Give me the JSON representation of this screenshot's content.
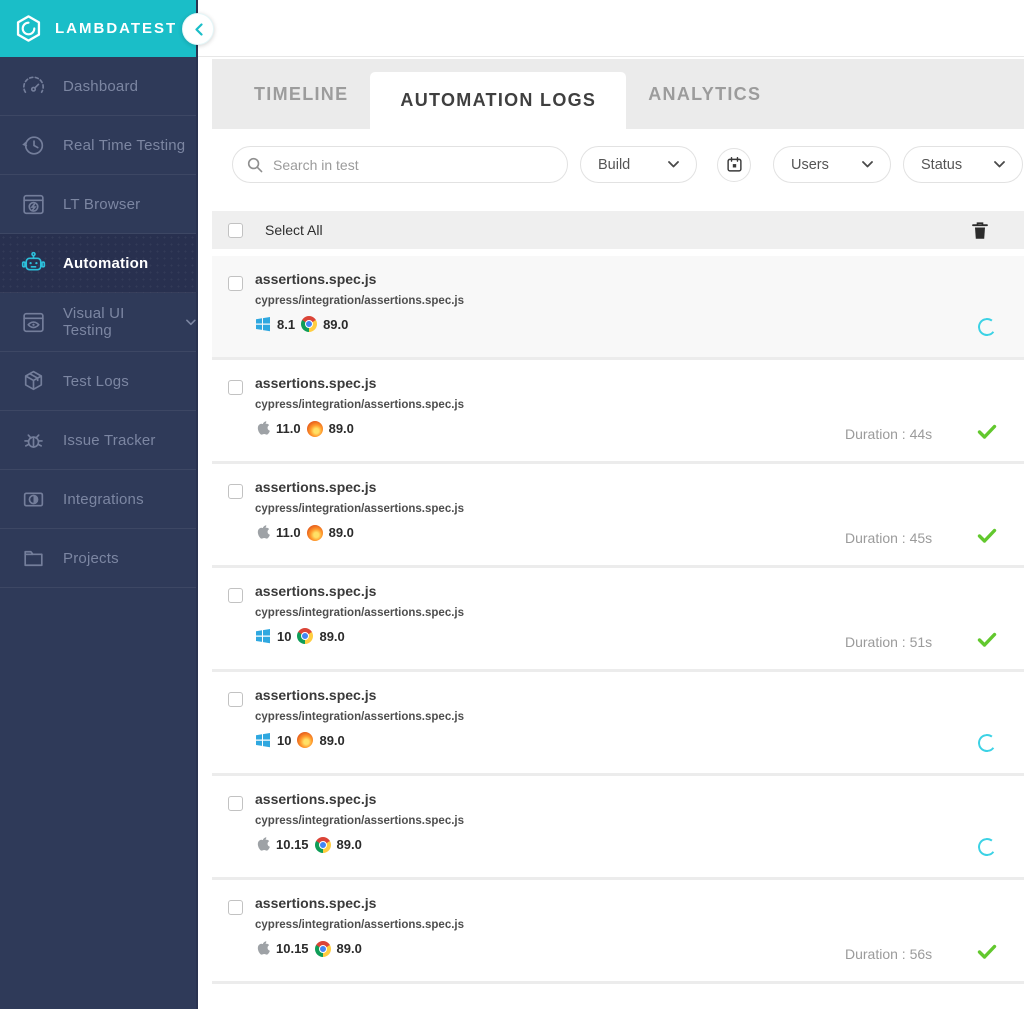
{
  "brand": {
    "name": "LAMBDATEST"
  },
  "colors": {
    "teal": "#1ABEC8",
    "sidebar_navy": "#2F3A59",
    "active_item_navy": "#28304F",
    "success_green": "#62C82E",
    "spinner_cyan": "#3CD2E5",
    "windows_blue": "#2FA8E0"
  },
  "sidebar": {
    "items": [
      {
        "label": "Dashboard",
        "icon": "dashboard-gauge-icon",
        "active": false
      },
      {
        "label": "Real Time Testing",
        "icon": "realtime-clock-icon",
        "active": false
      },
      {
        "label": "LT Browser",
        "icon": "lt-browser-icon",
        "active": false
      },
      {
        "label": "Automation",
        "icon": "automation-robot-icon",
        "active": true
      },
      {
        "label": "Visual UI Testing",
        "icon": "visual-ui-eye-icon",
        "active": false,
        "has_submenu": true
      },
      {
        "label": "Test Logs",
        "icon": "test-logs-box-icon",
        "active": false
      },
      {
        "label": "Issue Tracker",
        "icon": "issue-bug-icon",
        "active": false
      },
      {
        "label": "Integrations",
        "icon": "integrations-icon",
        "active": false
      },
      {
        "label": "Projects",
        "icon": "projects-folder-icon",
        "active": false
      }
    ]
  },
  "tabs": [
    {
      "label": "TIMELINE",
      "active": false
    },
    {
      "label": "AUTOMATION LOGS",
      "active": true
    },
    {
      "label": "ANALYTICS",
      "active": false
    }
  ],
  "filters": {
    "search_placeholder": "Search in test",
    "build": "Build",
    "users": "Users",
    "status": "Status"
  },
  "list": {
    "select_all": "Select All"
  },
  "rows": [
    {
      "title": "assertions.spec.js",
      "path": "cypress/integration/assertions.spec.js",
      "os": "windows",
      "os_version": "8.1",
      "browser": "chrome",
      "browser_version": "89.0",
      "duration": "",
      "status": "running"
    },
    {
      "title": "assertions.spec.js",
      "path": "cypress/integration/assertions.spec.js",
      "os": "apple",
      "os_version": "11.0",
      "browser": "firefox",
      "browser_version": "89.0",
      "duration": "Duration : 44s",
      "status": "passed"
    },
    {
      "title": "assertions.spec.js",
      "path": "cypress/integration/assertions.spec.js",
      "os": "apple",
      "os_version": "11.0",
      "browser": "firefox",
      "browser_version": "89.0",
      "duration": "Duration : 45s",
      "status": "passed"
    },
    {
      "title": "assertions.spec.js",
      "path": "cypress/integration/assertions.spec.js",
      "os": "windows",
      "os_version": "10",
      "browser": "chrome",
      "browser_version": "89.0",
      "duration": "Duration : 51s",
      "status": "passed"
    },
    {
      "title": "assertions.spec.js",
      "path": "cypress/integration/assertions.spec.js",
      "os": "windows",
      "os_version": "10",
      "browser": "firefox",
      "browser_version": "89.0",
      "duration": "",
      "status": "running"
    },
    {
      "title": "assertions.spec.js",
      "path": "cypress/integration/assertions.spec.js",
      "os": "apple",
      "os_version": "10.15",
      "browser": "chrome",
      "browser_version": "89.0",
      "duration": "",
      "status": "running"
    },
    {
      "title": "assertions.spec.js",
      "path": "cypress/integration/assertions.spec.js",
      "os": "apple",
      "os_version": "10.15",
      "browser": "chrome",
      "browser_version": "89.0",
      "duration": "Duration : 56s",
      "status": "passed"
    }
  ]
}
